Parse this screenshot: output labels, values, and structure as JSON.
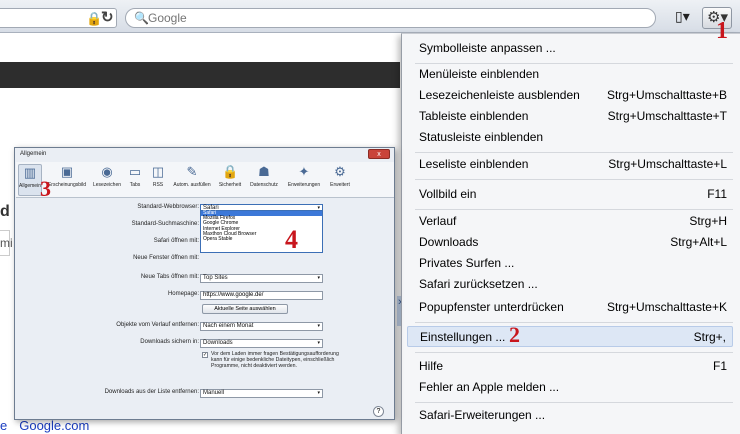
{
  "toolbar": {
    "lock_icon": "lock-icon",
    "reload_icon": "reload-icon",
    "search_placeholder": "Google",
    "page_menu_icon": "page-icon",
    "gear_icon": "gear-icon"
  },
  "page": {
    "partial_heading": "d",
    "partial_label": "mi",
    "footer_links": [
      "e",
      "Google.com"
    ]
  },
  "menu": {
    "items": [
      {
        "label": "Symbolleiste anpassen ...",
        "shortcut": ""
      },
      {
        "label": "Menüleiste einblenden",
        "shortcut": ""
      },
      {
        "label": "Lesezeichenleiste ausblenden",
        "shortcut": "Strg+Umschalttaste+B"
      },
      {
        "label": "Tableiste einblenden",
        "shortcut": "Strg+Umschalttaste+T"
      },
      {
        "label": "Statusleiste einblenden",
        "shortcut": ""
      },
      {
        "label": "Leseliste einblenden",
        "shortcut": "Strg+Umschalttaste+L"
      },
      {
        "label": "Vollbild ein",
        "shortcut": "F11"
      },
      {
        "label": "Verlauf",
        "shortcut": "Strg+H"
      },
      {
        "label": "Downloads",
        "shortcut": "Strg+Alt+L"
      },
      {
        "label": "Privates Surfen ...",
        "shortcut": ""
      },
      {
        "label": "Safari zurücksetzen ...",
        "shortcut": ""
      },
      {
        "label": "Popupfenster unterdrücken",
        "shortcut": "Strg+Umschalttaste+K"
      },
      {
        "label": "Einstellungen ...",
        "shortcut": "Strg+,"
      },
      {
        "label": "Hilfe",
        "shortcut": "F1"
      },
      {
        "label": "Fehler an Apple melden ...",
        "shortcut": ""
      },
      {
        "label": "Safari-Erweiterungen ...",
        "shortcut": ""
      }
    ]
  },
  "callouts": {
    "one": "1",
    "two": "2",
    "three": "3",
    "four": "4"
  },
  "dialog": {
    "title": "Allgemein",
    "close_label": "x",
    "tabs": [
      {
        "label": "Allgemein",
        "icon": "switch-icon"
      },
      {
        "label": "Erscheinungsbild",
        "icon": "picture-icon"
      },
      {
        "label": "Lesezeichen",
        "icon": "globe-icon"
      },
      {
        "label": "Tabs",
        "icon": "tabs-icon"
      },
      {
        "label": "RSS",
        "icon": "rss-icon"
      },
      {
        "label": "Autom. ausfüllen",
        "icon": "pencil-icon"
      },
      {
        "label": "Sicherheit",
        "icon": "lock-icon"
      },
      {
        "label": "Datenschutz",
        "icon": "person-icon"
      },
      {
        "label": "Erweiterungen",
        "icon": "puzzle-icon"
      },
      {
        "label": "Erweitert",
        "icon": "gear-icon"
      }
    ],
    "fields": {
      "default_browser_label": "Standard-Webbrowser:",
      "default_browser_value": "Safari",
      "default_search_label": "Standard-Suchmaschine:",
      "safari_opens_label": "Safari öffnen mit:",
      "new_windows_label": "Neue Fenster öffnen mit:",
      "new_tabs_label": "Neue Tabs öffnen mit:",
      "new_tabs_value": "Top Sites",
      "homepage_label": "Homepage:",
      "homepage_value": "https://www.google.de/",
      "current_page_button": "Aktuelle Seite auswählen",
      "remove_history_label": "Objekte vom Verlauf entfernen:",
      "remove_history_value": "Nach einem Monat",
      "save_downloads_label": "Downloads sichern in:",
      "save_downloads_value": "Downloads",
      "checkbox_text": "Vor dem Laden immer fragen Bestätigungsaufforderung kann für einige bedenkliche Dateitypen, einschließlich Programme, nicht deaktiviert werden.",
      "remove_downloads_label": "Downloads aus der Liste entfernen:",
      "remove_downloads_value": "Manuell",
      "help_label": "?"
    },
    "browser_options": [
      "Safari",
      "Mozilla Firefox",
      "Google Chrome",
      "Internet Explorer",
      "Maxthon Cloud Browser",
      "Opera Stable"
    ]
  }
}
